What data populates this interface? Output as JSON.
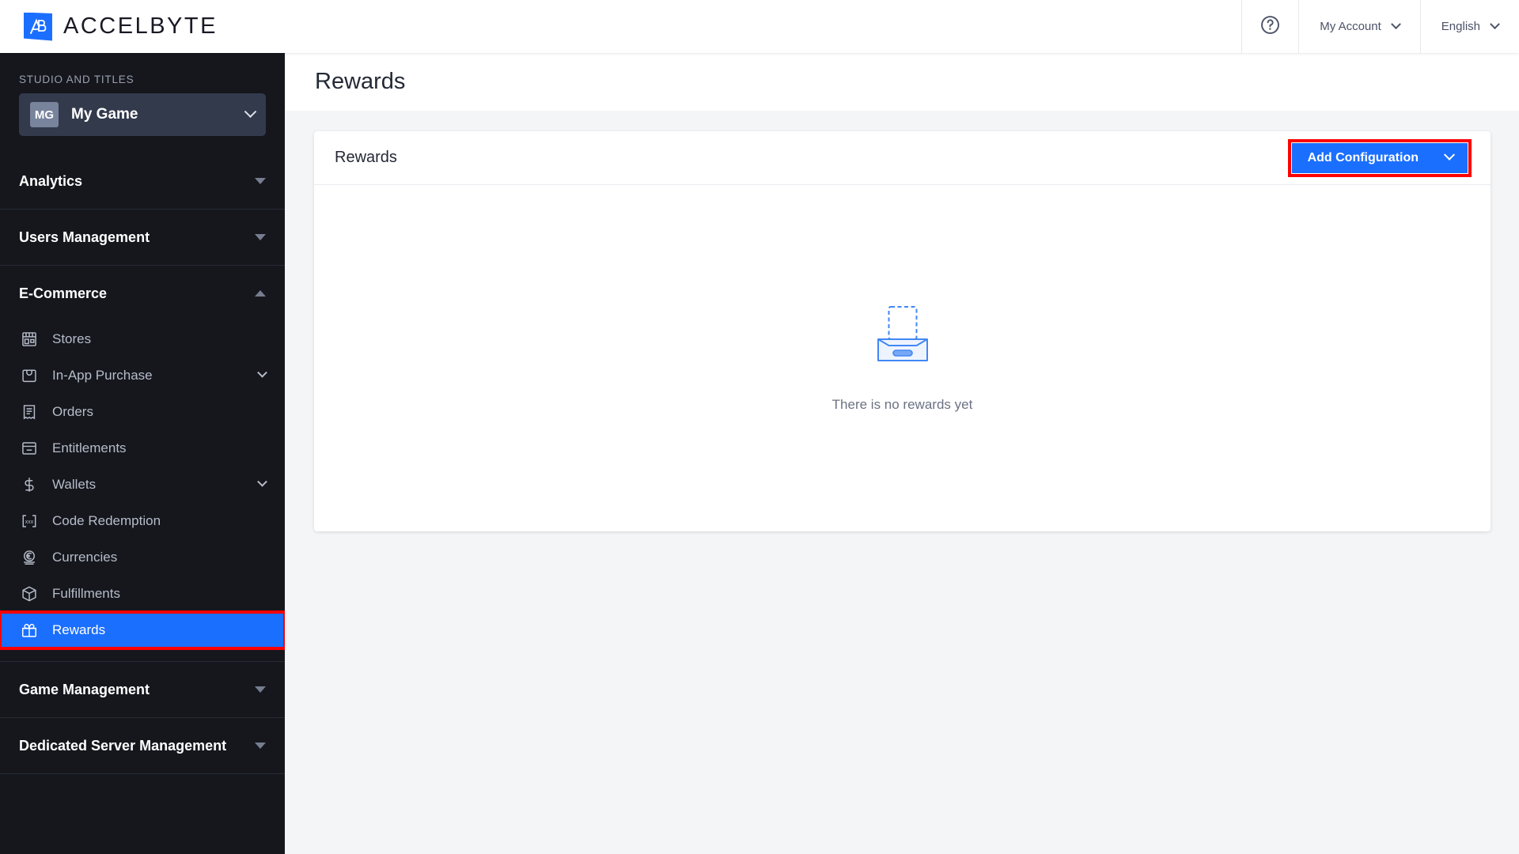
{
  "header": {
    "brand_prefix": "ACCEL",
    "brand_suffix": "BYTE",
    "brand_logo_alt": "accelbyte-logo",
    "help_icon": "help-circle-icon",
    "account_label": "My Account",
    "language_label": "English"
  },
  "sidebar": {
    "studio_label": "STUDIO AND TITLES",
    "studio": {
      "initials": "MG",
      "name": "My Game"
    },
    "groups": [
      {
        "title": "Analytics",
        "expanded": false,
        "items": []
      },
      {
        "title": "Users Management",
        "expanded": false,
        "items": []
      },
      {
        "title": "E-Commerce",
        "expanded": true,
        "items": [
          {
            "label": "Stores",
            "icon": "store-icon",
            "has_submenu": false,
            "active": false
          },
          {
            "label": "In-App Purchase",
            "icon": "shopping-bag-icon",
            "has_submenu": true,
            "active": false
          },
          {
            "label": "Orders",
            "icon": "receipt-icon",
            "has_submenu": false,
            "active": false
          },
          {
            "label": "Entitlements",
            "icon": "entitlement-icon",
            "has_submenu": false,
            "active": false
          },
          {
            "label": "Wallets",
            "icon": "dollar-icon",
            "has_submenu": true,
            "active": false
          },
          {
            "label": "Code Redemption",
            "icon": "code-bracket-icon",
            "has_submenu": false,
            "active": false
          },
          {
            "label": "Currencies",
            "icon": "currency-euro-icon",
            "has_submenu": false,
            "active": false
          },
          {
            "label": "Fulfillments",
            "icon": "box-icon",
            "has_submenu": false,
            "active": false
          },
          {
            "label": "Rewards",
            "icon": "gift-icon",
            "has_submenu": false,
            "active": true
          }
        ]
      },
      {
        "title": "Game Management",
        "expanded": false,
        "items": []
      },
      {
        "title": "Dedicated Server Management",
        "expanded": false,
        "items": []
      }
    ]
  },
  "main": {
    "page_title": "Rewards",
    "card": {
      "title": "Rewards",
      "add_button_label": "Add Configuration",
      "empty_state_text": "There is no rewards yet",
      "empty_state_icon": "empty-inbox-illustration"
    }
  },
  "colors": {
    "accent_blue": "#1b6fff",
    "highlight_red": "#fe0000",
    "sidebar_bg": "#15171d",
    "page_bg": "#f4f5f7"
  }
}
